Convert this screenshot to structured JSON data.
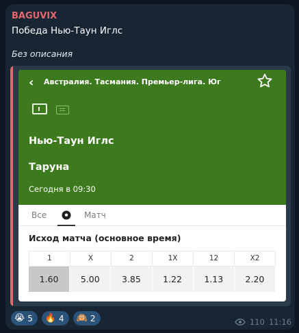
{
  "message": {
    "sender": "BAGUVIX",
    "title": "Победа Нью-Таун Иглс",
    "description": "Без описания"
  },
  "match": {
    "league": "Австралия. Тасмания. Премьер-лига. Юг",
    "team_home": "Нью-Таун Иглс",
    "team_away": "Таруна",
    "time": "Сегодня в 09:30",
    "tabs": {
      "all": "Все",
      "match": "Матч"
    },
    "market_title": "Исход матча (основное время)",
    "odds": [
      {
        "label": "1",
        "value": "1.60",
        "selected": true
      },
      {
        "label": "X",
        "value": "5.00",
        "selected": false
      },
      {
        "label": "2",
        "value": "3.85",
        "selected": false
      },
      {
        "label": "1X",
        "value": "1.22",
        "selected": false
      },
      {
        "label": "12",
        "value": "1.13",
        "selected": false
      },
      {
        "label": "X2",
        "value": "2.20",
        "selected": false
      }
    ],
    "colors": {
      "header_green": "#3d7a1d",
      "accent_red": "#e5676f"
    }
  },
  "reactions": [
    {
      "emoji": "😭",
      "count": "5"
    },
    {
      "emoji": "🔥",
      "count": "4"
    },
    {
      "emoji": "🙉",
      "count": "2"
    }
  ],
  "footer": {
    "views": "110",
    "time": "11:16"
  }
}
